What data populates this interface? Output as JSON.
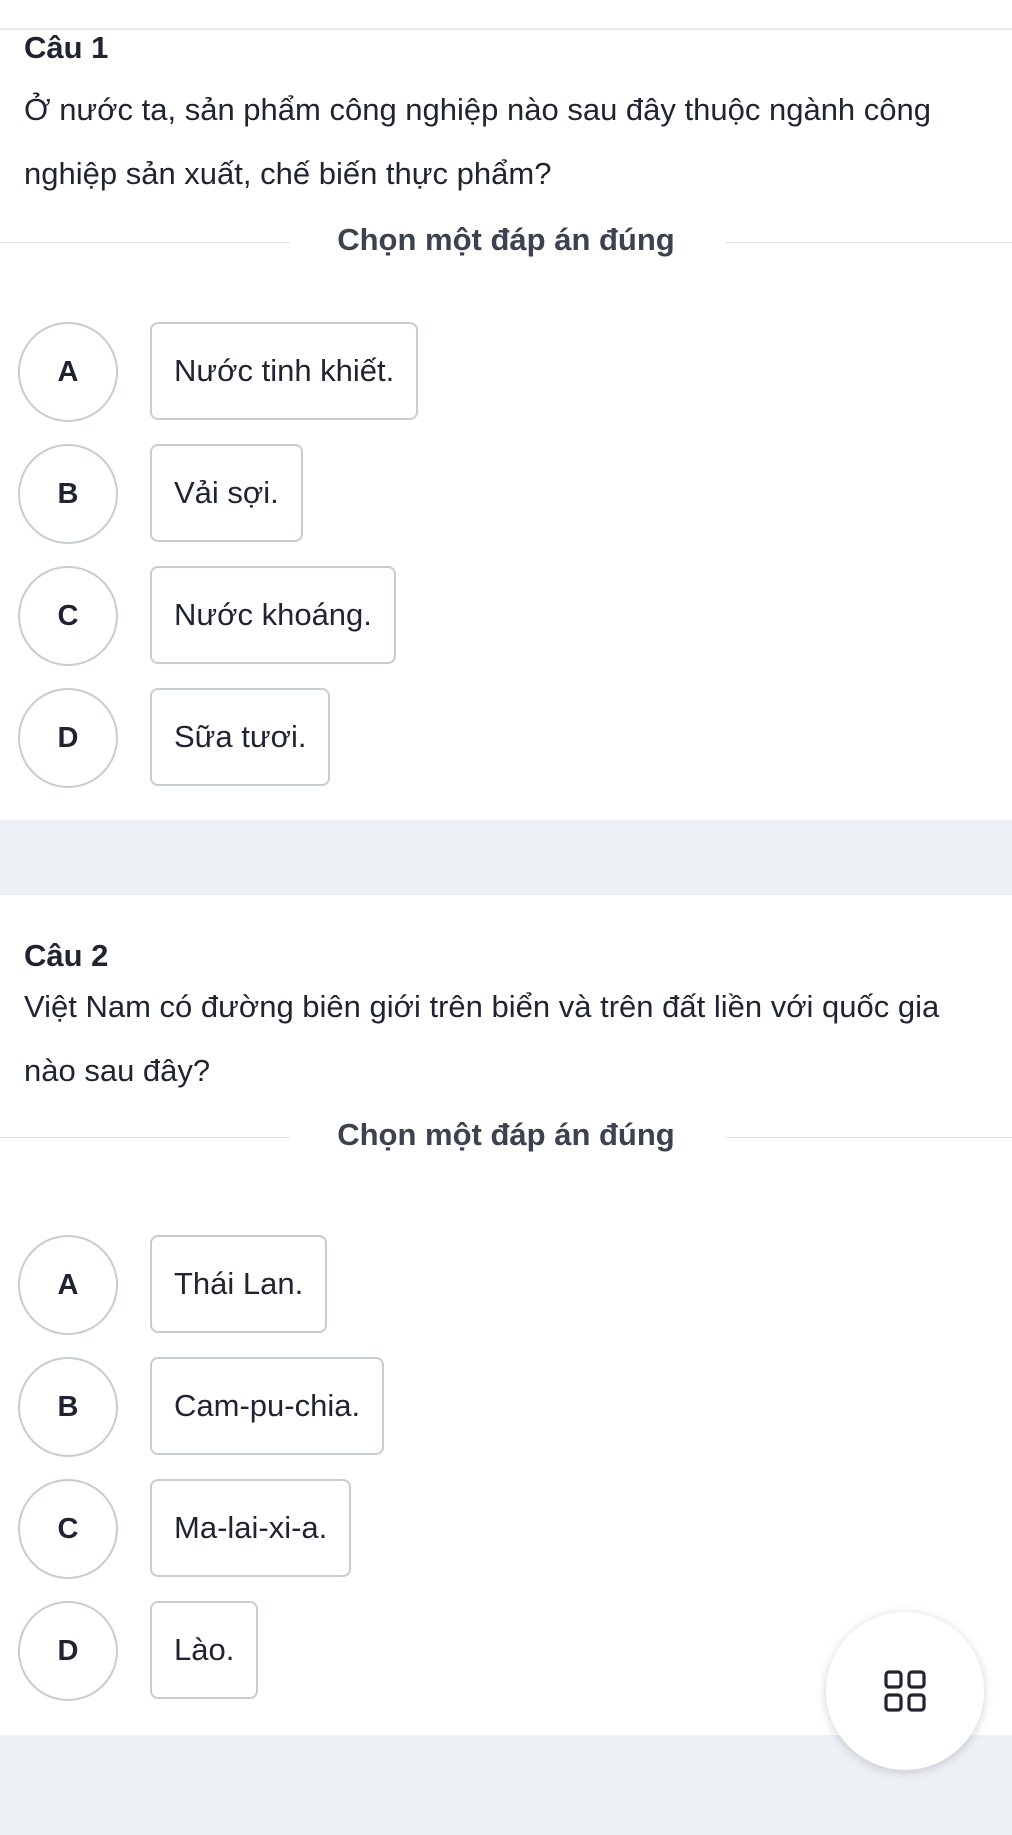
{
  "questions": [
    {
      "title": "Câu 1",
      "text": "Ở nước ta, sản phẩm công nghiệp nào sau đây thuộc ngành công nghiệp sản xuất, chế biến thực phẩm?",
      "prompt": "Chọn một đáp án đúng",
      "options": [
        {
          "letter": "A",
          "text": "Nước tinh khiết."
        },
        {
          "letter": "B",
          "text": "Vải sợi."
        },
        {
          "letter": "C",
          "text": "Nước khoáng."
        },
        {
          "letter": "D",
          "text": "Sữa tươi."
        }
      ]
    },
    {
      "title": "Câu 2",
      "text": "Việt Nam có đường biên giới trên biển và trên đất liền với quốc gia nào sau đây?",
      "prompt": "Chọn một đáp án đúng",
      "options": [
        {
          "letter": "A",
          "text": "Thái Lan."
        },
        {
          "letter": "B",
          "text": "Cam-pu-chia."
        },
        {
          "letter": "C",
          "text": "Ma-lai-xi-a."
        },
        {
          "letter": "D",
          "text": "Lào."
        }
      ]
    }
  ],
  "fab": {
    "icon": "grid-menu-icon"
  }
}
